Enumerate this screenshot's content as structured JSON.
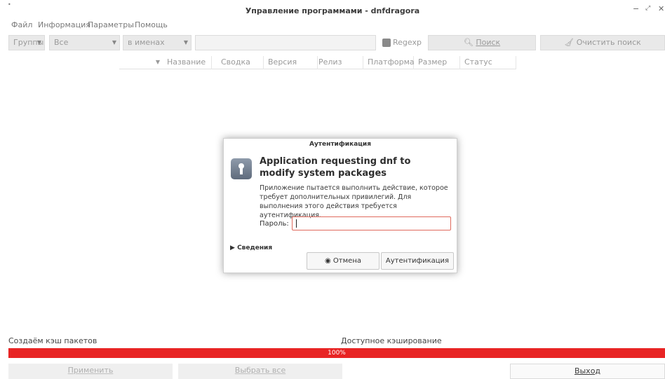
{
  "window": {
    "title": "Управление программами - dnfdragora",
    "sysmenu_icon": "•",
    "controls": {
      "minimize": "−",
      "maximize": "⤢",
      "close": "✕"
    }
  },
  "menu": [
    "Файл",
    "Информация",
    "Параметры",
    "Помощь"
  ],
  "toolbar": {
    "groups_label": "Группы",
    "filter_value": "Все",
    "search_field_value": "в именах",
    "search_input_value": "",
    "regexp_label": "Regexp",
    "search_button": "Поиск",
    "clear_search_button": "Очистить поиск"
  },
  "table": {
    "columns": [
      "Название",
      "Сводка",
      "Версия",
      "Релиз",
      "Платформа",
      "Размер",
      "Статус"
    ]
  },
  "dialog": {
    "title": "Аутентификация",
    "heading": "Application requesting dnf to modify system packages",
    "body": "Приложение пытается выполнить действие, которое требует дополнительных привилегий. Для выполнения этого действия требуется аутентификация.",
    "password_label": "Пароль:",
    "password_value": "",
    "details_label": "Сведения",
    "cancel_button": "Отмена",
    "auth_button": "Аутентификация"
  },
  "status": {
    "left": "Создаём кэш пакетов",
    "middle": "Доступное кэширование",
    "progress_text": "100%",
    "progress_fraction": 1.0,
    "progress_color": "#e82424"
  },
  "bottom": {
    "apply_button": "Применить",
    "select_all_button": "Выбрать все",
    "exit_button": "Выход"
  }
}
